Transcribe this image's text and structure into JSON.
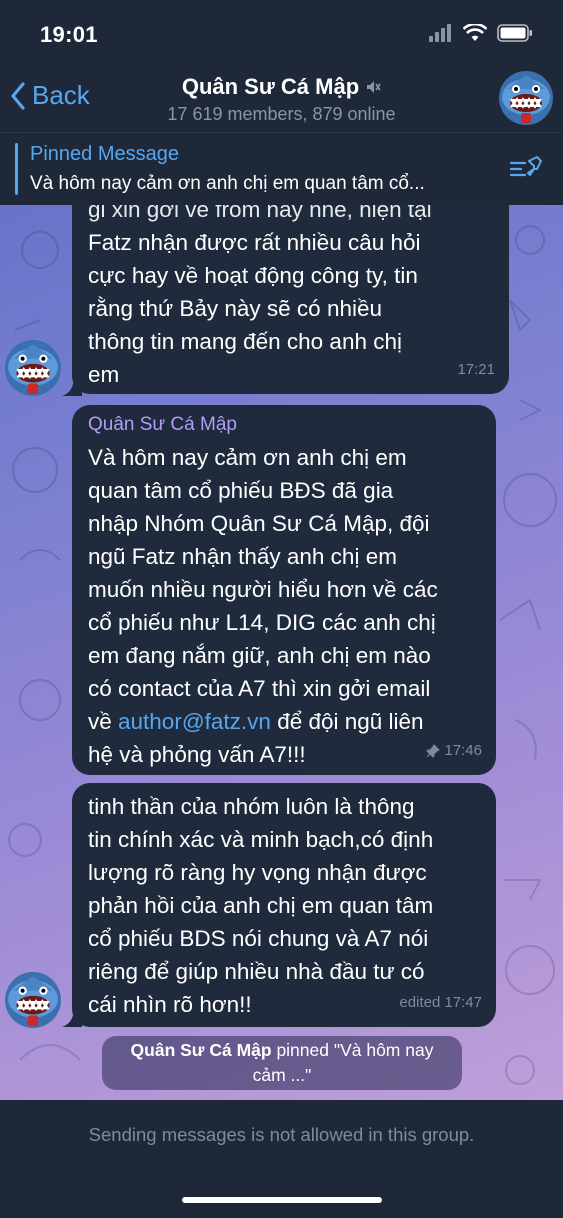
{
  "status_bar": {
    "time": "19:01"
  },
  "header": {
    "back_label": "Back",
    "title": "Quân Sư Cá Mập",
    "subtitle": "17 619 members, 879 online"
  },
  "pinned": {
    "title": "Pinned Message",
    "text": "Và hôm nay cảm ơn anh chị em quan tâm cổ..."
  },
  "messages": [
    {
      "lines": [
        "gi xin gởi về from này nhé, hiện tại",
        "Fatz nhận được rất nhiều câu hỏi",
        "cực hay về hoạt động công ty, tin",
        "rằng thứ Bảy này sẽ có nhiều",
        "thông tin mang đến cho anh chị",
        "em"
      ],
      "time": "17:21"
    },
    {
      "sender": "Quân Sư Cá Mập",
      "lines": [
        "Và hôm nay cảm ơn anh chị em",
        "quan tâm cổ phiếu BĐS đã gia",
        "nhập Nhóm Quân Sư Cá Mập, đội",
        "ngũ Fatz nhận thấy anh chị em",
        "muốn nhiều người hiểu hơn về các",
        "cổ phiếu như L14, DIG các anh chị",
        "em đang nắm giữ, anh chị em nào",
        "có contact của A7 thì xin gởi email"
      ],
      "line9_prefix": "về ",
      "link": "author@fatz.vn",
      "line9_suffix": " để đội ngũ liên",
      "line10": "hệ và phỏng vấn A7!!!",
      "time": "17:46"
    },
    {
      "lines": [
        "tinh thần của nhóm luôn là thông",
        "tin chính xác và minh bạch,có định",
        "lượng rõ ràng hy vọng nhận được",
        "phản hồi của anh chị em quan tâm",
        "cổ phiếu BDS nói chung và A7 nói",
        "riêng để giúp nhiều nhà đầu tư có",
        "cái nhìn rõ hơn!!"
      ],
      "time": "edited 17:47"
    }
  ],
  "service_message": {
    "actor": "Quân Sư Cá Mập",
    "action": " pinned \"Và hôm nay",
    "action2": "cảm ...\""
  },
  "footer": {
    "notice": "Sending messages is not allowed in this group."
  },
  "colors": {
    "accent": "#55a7f0",
    "bubble": "#1f2b3c",
    "sender": "#b49cf4",
    "bar": "#1f2838"
  }
}
